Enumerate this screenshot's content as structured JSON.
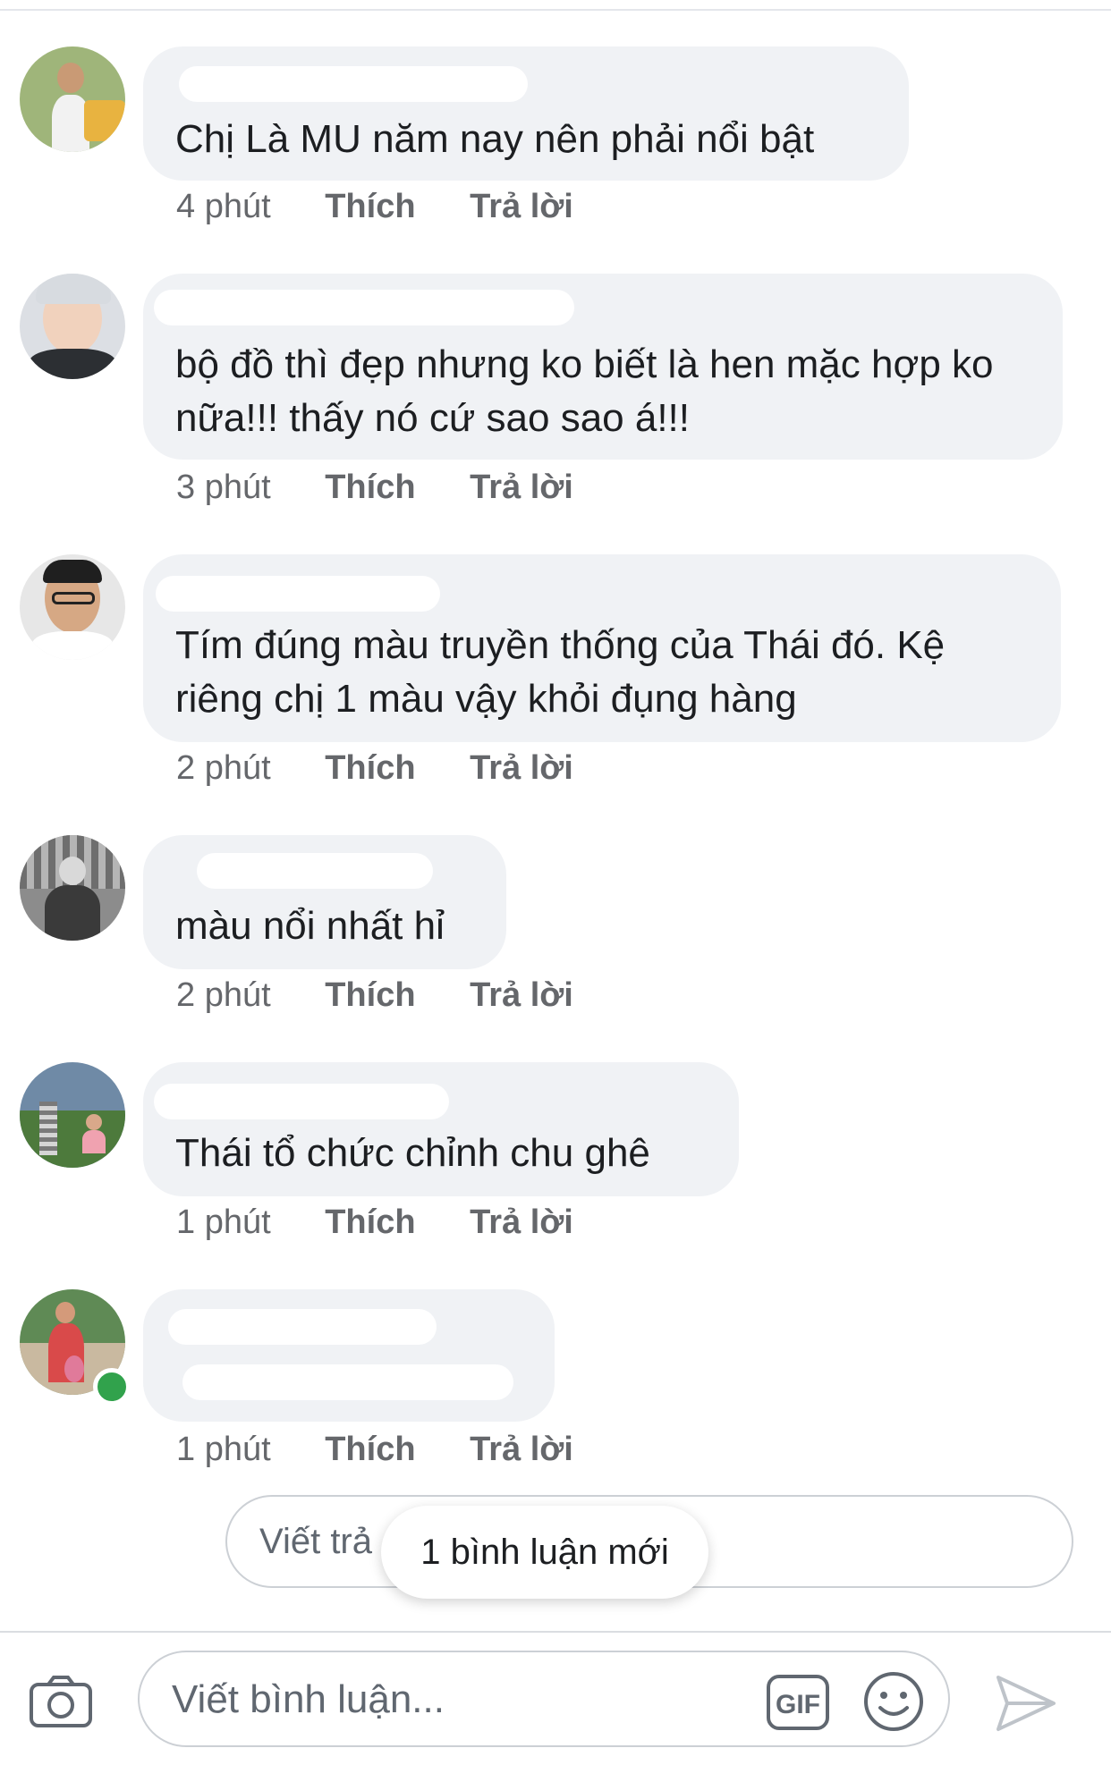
{
  "comments": [
    {
      "text": "Chị Là MU năm nay nên phải nổi bật",
      "time": "4 phút",
      "like": "Thích",
      "reply": "Trả lời"
    },
    {
      "text": "bộ đồ thì đẹp nhưng ko biết là hen mặc hợp ko nữa!!! thấy nó cứ sao sao á!!!",
      "time": "3 phút",
      "like": "Thích",
      "reply": "Trả lời"
    },
    {
      "text": "Tím đúng màu truyền thống của Thái đó. Kệ riêng chị 1 màu vậy khỏi đụng hàng",
      "time": "2 phút",
      "like": "Thích",
      "reply": "Trả lời"
    },
    {
      "text": "màu nổi nhất hỉ",
      "time": "2 phút",
      "like": "Thích",
      "reply": "Trả lời"
    },
    {
      "text": "Thái tổ chức chỉnh chu ghê",
      "time": "1 phút",
      "like": "Thích",
      "reply": "Trả lời"
    },
    {
      "text": "",
      "time": "1 phút",
      "like": "Thích",
      "reply": "Trả lời"
    }
  ],
  "reply_box": {
    "placeholder": "Viết trả"
  },
  "new_comments_pill": "1 bình luận mới",
  "composer": {
    "placeholder": "Viết bình luận...",
    "gif_label": "GIF"
  },
  "icons": [
    "camera-icon",
    "gif-icon",
    "emoji-icon",
    "send-icon"
  ],
  "colors": {
    "bubble": "#f0f2f5",
    "meta": "#65676b",
    "online": "#31a24c"
  }
}
